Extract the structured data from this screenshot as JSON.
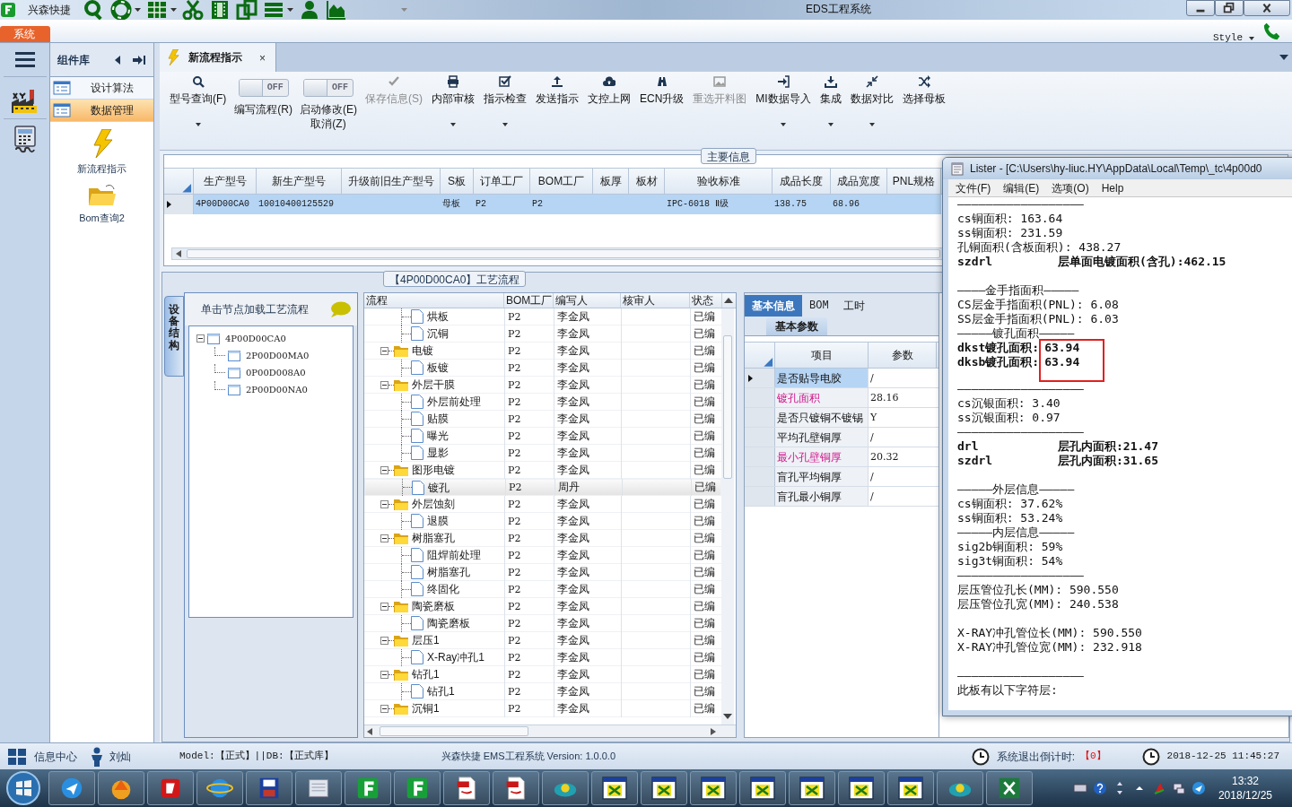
{
  "window": {
    "app_name": "兴森快捷",
    "title": "EDS工程系统"
  },
  "ribbon": {
    "system_tab": "系统",
    "style_menu": "Style"
  },
  "component_panel": {
    "title": "组件库",
    "items": [
      {
        "label": "设计算法",
        "selected": false
      },
      {
        "label": "数据管理",
        "selected": true
      }
    ],
    "shortcuts": [
      {
        "kind": "bolt",
        "label": "新流程指示"
      },
      {
        "kind": "folder",
        "label": "Bom查询2"
      }
    ]
  },
  "document_tab": {
    "label": "新流程指示",
    "close": "×"
  },
  "toolbar": [
    {
      "kind": "button",
      "label": "型号查询(F)",
      "disabled": false,
      "dropdown": true
    },
    {
      "kind": "toggle",
      "state_text": "OFF",
      "on": false,
      "label": "编写流程(R)"
    },
    {
      "kind": "toggle",
      "state_text": "OFF",
      "on": false,
      "label": "启动修改(E)\n取消(Z)"
    },
    {
      "kind": "button",
      "label": "保存信息(S)",
      "disabled": true,
      "dropdown": false
    },
    {
      "kind": "button",
      "label": "内部审核",
      "disabled": false,
      "dropdown": true
    },
    {
      "kind": "button",
      "label": "指示检查",
      "disabled": false,
      "dropdown": true
    },
    {
      "kind": "button",
      "label": "发送指示",
      "disabled": false,
      "dropdown": false
    },
    {
      "kind": "button",
      "label": "文控上网",
      "disabled": false,
      "dropdown": false
    },
    {
      "kind": "button",
      "label": "ECN升级",
      "disabled": false,
      "dropdown": false
    },
    {
      "kind": "button",
      "label": "重选开料图",
      "disabled": true,
      "dropdown": false
    },
    {
      "kind": "button",
      "label": "MI数据导入",
      "disabled": false,
      "dropdown": true
    },
    {
      "kind": "button",
      "label": "集成",
      "disabled": false,
      "dropdown": true
    },
    {
      "kind": "button",
      "label": "数据对比",
      "disabled": false,
      "dropdown": true
    },
    {
      "kind": "button",
      "label": "选择母板",
      "disabled": false,
      "dropdown": false
    }
  ],
  "main_info": {
    "title": "主要信息",
    "columns": [
      "生产型号",
      "新生产型号",
      "升级前旧生产型号",
      "S板",
      "订单工厂",
      "BOM工厂",
      "板厚",
      "板材",
      "验收标准",
      "成品长度",
      "成品宽度",
      "PNL规格"
    ],
    "rows": [
      {
        "selected": true,
        "cells": [
          "4P00D00CA0",
          "10010400125529",
          null,
          "母板",
          "P2",
          "P2",
          null,
          null,
          "IPC-6018 Ⅱ级",
          "138.75",
          "68.96",
          null
        ]
      }
    ]
  },
  "process_section": {
    "title": "【4P00D00CA0】工艺流程",
    "side_tab": "设备结构",
    "device_tree": {
      "hint": "单击节点加载工艺流程",
      "nodes": [
        {
          "label": "4P00D00CA0",
          "expanded": true,
          "children": [
            {
              "label": "2P00D00MA0"
            },
            {
              "label": "0P00D008A0"
            },
            {
              "label": "2P00D00NA0"
            }
          ]
        }
      ]
    },
    "process_grid": {
      "columns": [
        "流程",
        "BOM工厂",
        "编写人",
        "核审人",
        "状态"
      ],
      "groups": [
        {
          "children": [
            {
              "label": "烘板",
              "bom": "P2",
              "writer": "李金凤",
              "status": "已编",
              "selected": false
            },
            {
              "label": "沉铜",
              "bom": "P2",
              "writer": "李金凤",
              "status": "已编",
              "selected": false
            }
          ]
        },
        {
          "label": "电镀",
          "bom": "P2",
          "writer": "李金凤",
          "status": "已编",
          "selected": false,
          "expanded": true,
          "children": [
            {
              "label": "板镀",
              "bom": "P2",
              "writer": "李金凤",
              "status": "已编",
              "selected": false
            }
          ]
        },
        {
          "label": "外层干膜",
          "bom": "P2",
          "writer": "李金凤",
          "status": "已编",
          "selected": false,
          "expanded": true,
          "children": [
            {
              "label": "外层前处理",
              "bom": "P2",
              "writer": "李金凤",
              "status": "已编",
              "selected": false
            },
            {
              "label": "贴膜",
              "bom": "P2",
              "writer": "李金凤",
              "status": "已编",
              "selected": false
            },
            {
              "label": "曝光",
              "bom": "P2",
              "writer": "李金凤",
              "status": "已编",
              "selected": false
            },
            {
              "label": "显影",
              "bom": "P2",
              "writer": "李金凤",
              "status": "已编",
              "selected": false
            }
          ]
        },
        {
          "label": "图形电镀",
          "bom": "P2",
          "writer": "李金凤",
          "status": "已编",
          "selected": false,
          "expanded": true,
          "children": [
            {
              "label": "镀孔",
              "bom": "P2",
              "writer": "周丹",
              "status": "已编",
              "selected": true
            }
          ]
        },
        {
          "label": "外层蚀刻",
          "bom": "P2",
          "writer": "李金凤",
          "status": "已编",
          "selected": false,
          "expanded": true,
          "children": [
            {
              "label": "退膜",
              "bom": "P2",
              "writer": "李金凤",
              "status": "已编",
              "selected": false
            }
          ]
        },
        {
          "label": "树脂塞孔",
          "bom": "P2",
          "writer": "李金凤",
          "status": "已编",
          "selected": false,
          "expanded": true,
          "children": [
            {
              "label": "阻焊前处理",
              "bom": "P2",
              "writer": "李金凤",
              "status": "已编",
              "selected": false
            },
            {
              "label": "树脂塞孔",
              "bom": "P2",
              "writer": "李金凤",
              "status": "已编",
              "selected": false
            },
            {
              "label": "终固化",
              "bom": "P2",
              "writer": "李金凤",
              "status": "已编",
              "selected": false
            }
          ]
        },
        {
          "label": "陶瓷磨板",
          "bom": "P2",
          "writer": "李金凤",
          "status": "已编",
          "selected": false,
          "expanded": true,
          "children": [
            {
              "label": "陶瓷磨板",
              "bom": "P2",
              "writer": "李金凤",
              "status": "已编",
              "selected": false
            }
          ]
        },
        {
          "label": "层压1",
          "bom": "P2",
          "writer": "李金凤",
          "status": "已编",
          "selected": false,
          "expanded": true,
          "children": [
            {
              "label": "X-Ray冲孔1",
              "bom": "P2",
              "writer": "李金凤",
              "status": "已编",
              "selected": false
            }
          ]
        },
        {
          "label": "钻孔1",
          "bom": "P2",
          "writer": "李金凤",
          "status": "已编",
          "selected": false,
          "expanded": true,
          "children": [
            {
              "label": "钻孔1",
              "bom": "P2",
              "writer": "李金凤",
              "status": "已编",
              "selected": false
            }
          ]
        },
        {
          "label": "沉铜1",
          "bom": "P2",
          "writer": "李金凤",
          "status": "已编",
          "selected": false,
          "expanded": true
        }
      ]
    },
    "info_panel": {
      "tabs": [
        {
          "label": "基本信息",
          "selected": true
        },
        {
          "label": "BOM",
          "selected": false
        },
        {
          "label": "工时",
          "selected": false
        }
      ],
      "sub_tab": "基本参数",
      "columns": [
        "项目",
        "参数"
      ],
      "rows": [
        {
          "item": "是否贴导电胶",
          "value": "/",
          "required": false,
          "selected": true
        },
        {
          "item": "镀孔面积",
          "value": "28.16",
          "required": true,
          "selected": false
        },
        {
          "item": "是否只镀铜不镀锡",
          "value": "Y",
          "required": false,
          "selected": false
        },
        {
          "item": "平均孔壁铜厚",
          "value": "/",
          "required": false,
          "selected": false
        },
        {
          "item": "最小孔壁铜厚",
          "value": "20.32",
          "required": true,
          "selected": false
        },
        {
          "item": "盲孔平均铜厚",
          "value": "/",
          "required": false,
          "selected": false
        },
        {
          "item": "盲孔最小铜厚",
          "value": "/",
          "required": false,
          "selected": false
        }
      ]
    }
  },
  "lister": {
    "title": "Lister - [C:\\Users\\hy-liuc.HY\\AppData\\Local\\Temp\\_tc\\4p00d0",
    "menu": [
      "文件(F)",
      "编辑(E)",
      "选项(O)",
      "Help"
    ],
    "lines": [
      {
        "kind": "text",
        "text": "——————————————————"
      },
      {
        "kind": "text",
        "text": "cs铜面积: 163.64"
      },
      {
        "kind": "text",
        "text": "ss铜面积: 231.59"
      },
      {
        "kind": "text",
        "text": "孔铜面积(含板面积): 438.27"
      },
      {
        "kind": "pair",
        "label": "szdrl",
        "value": "层单面电镀面积(含孔):462.15"
      },
      {
        "kind": "gap"
      },
      {
        "kind": "text",
        "text": "————金手指面积—————"
      },
      {
        "kind": "text",
        "text": "CS层金手指面积(PNL): 6.08"
      },
      {
        "kind": "text",
        "text": "SS层金手指面积(PNL): 6.03"
      },
      {
        "kind": "text",
        "text": "—————镀孔面积—————"
      },
      {
        "kind": "boxed",
        "rows": [
          {
            "label": "dkst镀孔面积:",
            "value": "63.94"
          },
          {
            "label": "dksb镀孔面积:",
            "value": "63.94"
          }
        ]
      },
      {
        "kind": "text",
        "text": "——————————————————"
      },
      {
        "kind": "text",
        "text": "cs沉银面积: 3.40"
      },
      {
        "kind": "text",
        "text": "ss沉银面积: 0.97"
      },
      {
        "kind": "text",
        "text": "——————————————————"
      },
      {
        "kind": "pair",
        "label": "drl",
        "value": "层孔内面积:21.47"
      },
      {
        "kind": "pair",
        "label": "szdrl",
        "value": "层孔内面积:31.65"
      },
      {
        "kind": "gap"
      },
      {
        "kind": "text",
        "text": "—————外层信息—————"
      },
      {
        "kind": "text",
        "text": "cs铜面积: 37.62%"
      },
      {
        "kind": "text",
        "text": "ss铜面积: 53.24%"
      },
      {
        "kind": "text",
        "text": "—————内层信息—————"
      },
      {
        "kind": "text",
        "text": "sig2b铜面积: 59%"
      },
      {
        "kind": "text",
        "text": "sig3t铜面积: 54%"
      },
      {
        "kind": "text",
        "text": "——————————————————"
      },
      {
        "kind": "text",
        "text": "层压管位孔长(MM): 590.550"
      },
      {
        "kind": "text",
        "text": "层压管位孔宽(MM): 240.538"
      },
      {
        "kind": "gap"
      },
      {
        "kind": "text",
        "text": "X-RAY冲孔管位长(MM): 590.550"
      },
      {
        "kind": "text",
        "text": "X-RAY冲孔管位宽(MM): 232.918"
      },
      {
        "kind": "gap"
      },
      {
        "kind": "text",
        "text": "——————————————————"
      },
      {
        "kind": "text",
        "text": "此板有以下字符层:"
      }
    ]
  },
  "status_bar": {
    "info_center": "信息中心",
    "user": "刘灿",
    "environment": "Model:【正式】||DB:【正式库】",
    "product": "兴森快捷 EMS工程系统 Version: 1.0.0.0",
    "countdown_label": "系统退出倒计时:",
    "countdown_value": "【0】",
    "datetime": "2018-12-25 11:45:27"
  },
  "taskbar": {
    "time": "13:32",
    "date": "2018/12/25"
  }
}
